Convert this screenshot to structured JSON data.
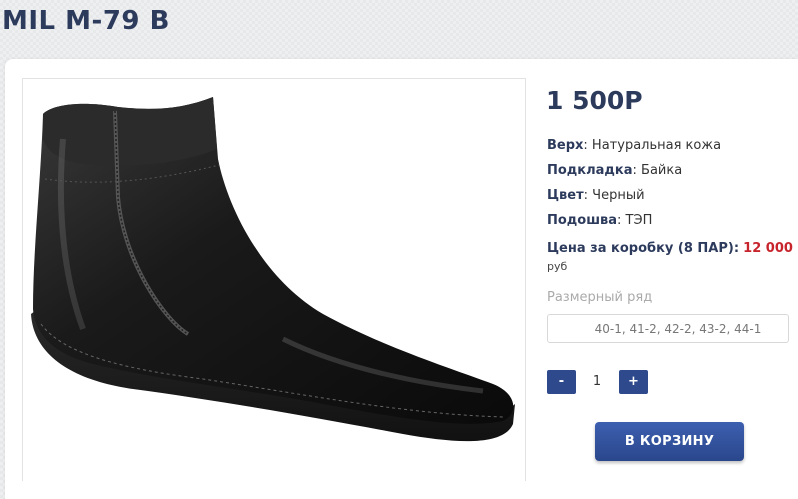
{
  "product": {
    "title": "MIL M-79 B",
    "price": "1 500Р",
    "specs": [
      {
        "label": "Верх",
        "value": ": Натуральная кожа"
      },
      {
        "label": "Подкладка",
        "value": ": Байка"
      },
      {
        "label": "Цвет",
        "value": ": Черный"
      },
      {
        "label": "Подошва",
        "value": ": ТЭП"
      }
    ],
    "box_price_label": "Цена за коробку (8 ПАР):",
    "box_price_value": "12 000",
    "currency": "руб",
    "size_label": "Размерный ряд",
    "size_value": "40-1, 41-2, 42-2, 43-2, 44-1"
  },
  "quantity": {
    "minus": "-",
    "value": "1",
    "plus": "+"
  },
  "cart_button": "В КОРЗИНУ",
  "image": {
    "alt": "black-leather-ankle-boot"
  }
}
